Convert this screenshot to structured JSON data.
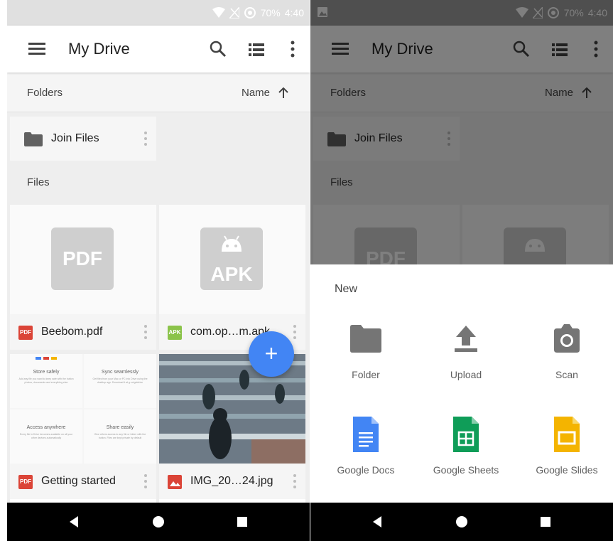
{
  "status": {
    "battery": "70%",
    "time": "4:40"
  },
  "appbar": {
    "title": "My Drive"
  },
  "header": {
    "folders_label": "Folders",
    "sort_label": "Name"
  },
  "folder": {
    "name": "Join Files"
  },
  "files_label": "Files",
  "files": [
    {
      "name": "Beebom.pdf",
      "thumb": "PDF",
      "type": "PDF"
    },
    {
      "name": "com.op…m.apk",
      "thumb": "APK",
      "type": "APK"
    },
    {
      "name": "Getting started",
      "type": "PDF"
    },
    {
      "name": "IMG_20…24.jpg"
    }
  ],
  "getting_started": {
    "cells": [
      {
        "heading": "Store safely",
        "text": "Add any file you want to keep safe with the button photos, documents and everything else"
      },
      {
        "heading": "Sync seamlessly",
        "text": "Get files from your Mac or PC into Drive using the desktop app. Download it at g.co/getdrive"
      },
      {
        "heading": "Access anywhere",
        "text": "Every file in Drive becomes available on all your other devices automatically"
      },
      {
        "heading": "Share easily",
        "text": "Give others access to any file or folder with the button. Files are kept private by default"
      }
    ]
  },
  "fab": {
    "label": "+"
  },
  "sheet": {
    "title": "New",
    "items": [
      {
        "label": "Folder"
      },
      {
        "label": "Upload"
      },
      {
        "label": "Scan"
      },
      {
        "label": "Google Docs"
      },
      {
        "label": "Google Sheets"
      },
      {
        "label": "Google Slides"
      }
    ]
  },
  "colors": {
    "fab": "#4285f4",
    "pdf": "#db4437",
    "apk": "#8bc34a",
    "image": "#db4437",
    "docs": "#4285f4",
    "sheets": "#0f9d58",
    "slides": "#f4b400",
    "icon_grey": "#757575"
  },
  "icons": [
    "menu-icon",
    "search-icon",
    "list-view-icon",
    "more-vert-icon",
    "arrow-up-icon",
    "folder-icon",
    "wifi-icon",
    "signal-icon",
    "data-saver-icon",
    "back-icon",
    "home-icon",
    "recents-icon",
    "upload-icon",
    "camera-icon",
    "docs-icon",
    "sheets-icon",
    "slides-icon",
    "image-icon"
  ]
}
